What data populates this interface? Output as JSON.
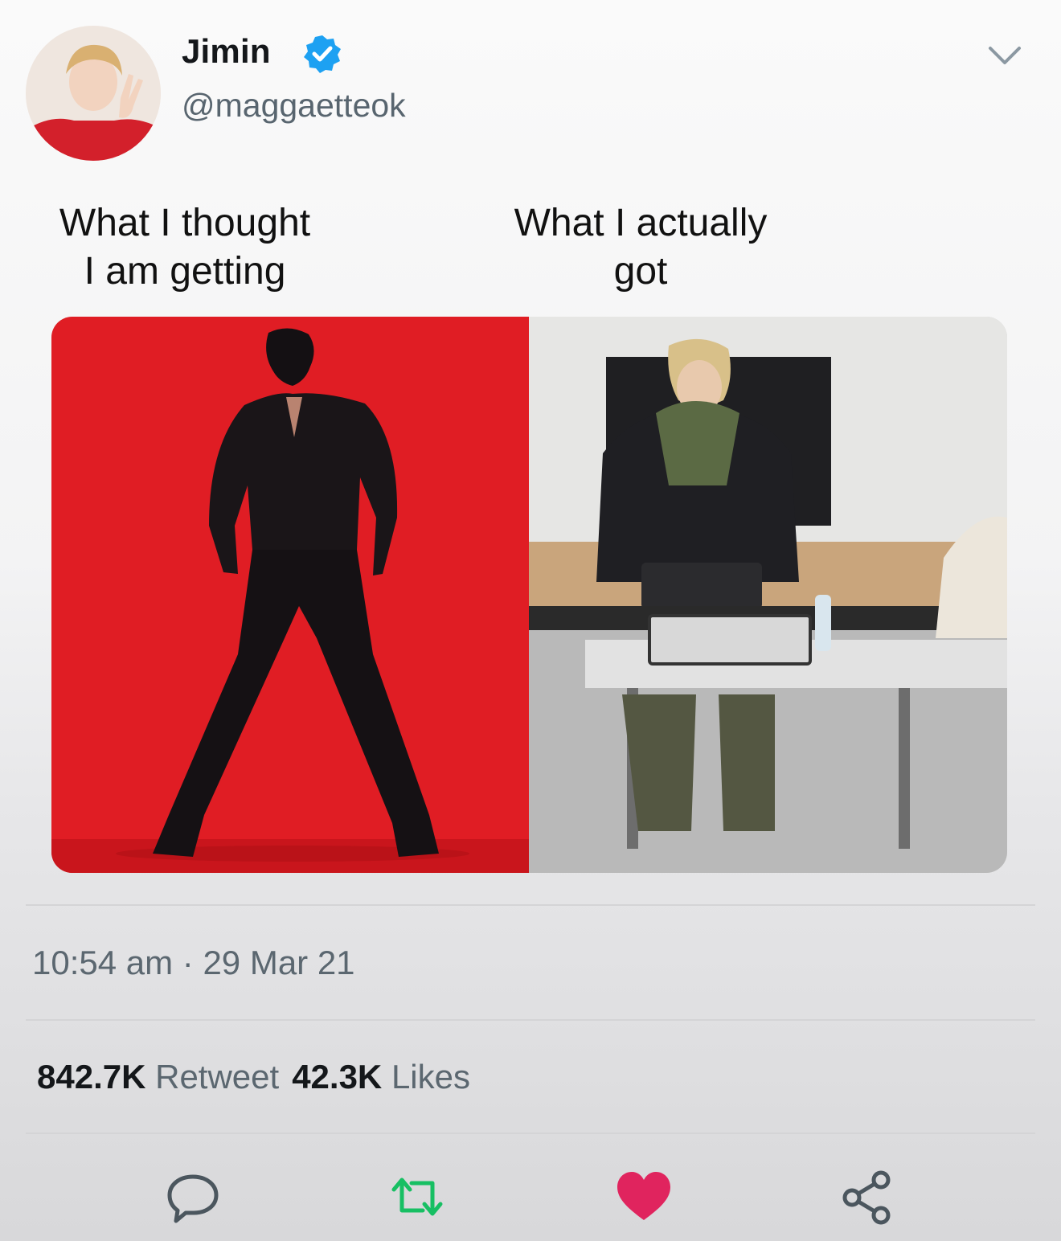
{
  "tweet": {
    "author": {
      "display_name": "Jimin",
      "handle": "@maggaetteok",
      "verified": true,
      "avatar_icon": "profile-photo"
    },
    "caption_left": "What I thought\nI am getting",
    "caption_right": "What I actually\ngot",
    "timestamp": "10:54 am · 29 Mar 21",
    "stats": {
      "retweets_count": "842.7K",
      "retweets_label": "Retweet",
      "likes_count": "42.3K",
      "likes_label": "Likes"
    },
    "actions": [
      {
        "name": "reply",
        "icon": "speech-bubble-icon"
      },
      {
        "name": "retweet",
        "icon": "retweet-arrows-icon",
        "color": "#17bf63"
      },
      {
        "name": "like",
        "icon": "heart-icon",
        "color": "#e0245e"
      },
      {
        "name": "share",
        "icon": "share-nodes-icon"
      }
    ],
    "colors": {
      "verified": "#1da1f2",
      "retweet": "#17bf63",
      "like": "#e0245e",
      "secondary_text": "#5b6770"
    }
  }
}
